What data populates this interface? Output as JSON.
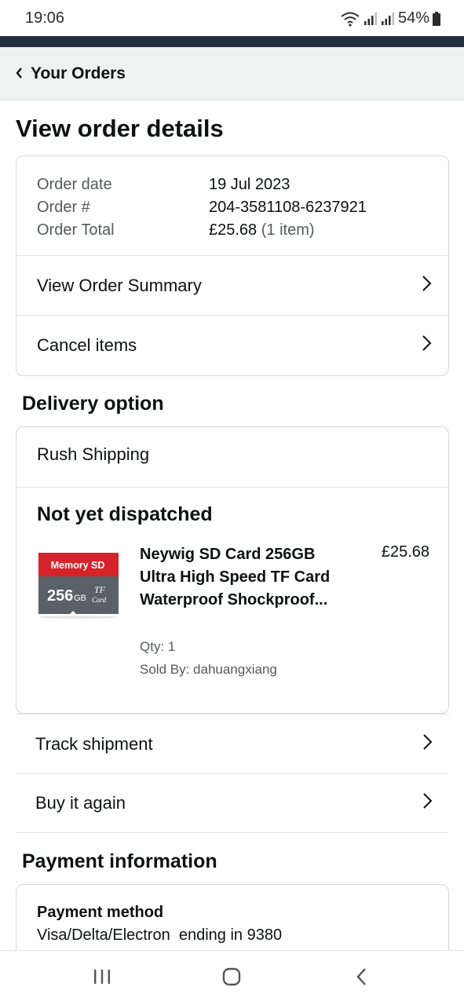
{
  "status": {
    "time": "19:06",
    "battery": "54%",
    "icons": [
      "wifi-icon",
      "signal-icon",
      "signal-icon",
      "battery-icon"
    ]
  },
  "nav": {
    "back_label": "Your Orders"
  },
  "page": {
    "title": "View order details"
  },
  "order": {
    "date_label": "Order date",
    "date_value": "19 Jul 2023",
    "number_label": "Order #",
    "number_value": "204-3581108-6237921",
    "total_label": "Order Total",
    "total_value": "£25.68",
    "total_count": "(1 item)",
    "summary_link": "View Order Summary",
    "cancel_link": "Cancel items"
  },
  "delivery": {
    "section_title": "Delivery option",
    "option": "Rush Shipping",
    "status": "Not yet dispatched",
    "product": {
      "image_label_top": "Memory SD",
      "image_capacity": "256",
      "image_unit": "GB",
      "image_tf": "TF",
      "image_card": "Card",
      "name": "Neywig SD Card 256GB Ultra High Speed TF Card Waterproof Shockproof...",
      "price": "£25.68",
      "qty": "Qty: 1",
      "seller": "Sold By: dahuangxiang"
    },
    "track_link": "Track shipment",
    "buy_again_link": "Buy it again"
  },
  "payment": {
    "section_title": "Payment information",
    "method_label": "Payment method",
    "method_value": "Visa/Delta/Electron  ending in 9380"
  },
  "colors": {
    "nav_strip": "#232f3e",
    "card_red": "#d6232a",
    "card_gray": "#5b5f66"
  }
}
